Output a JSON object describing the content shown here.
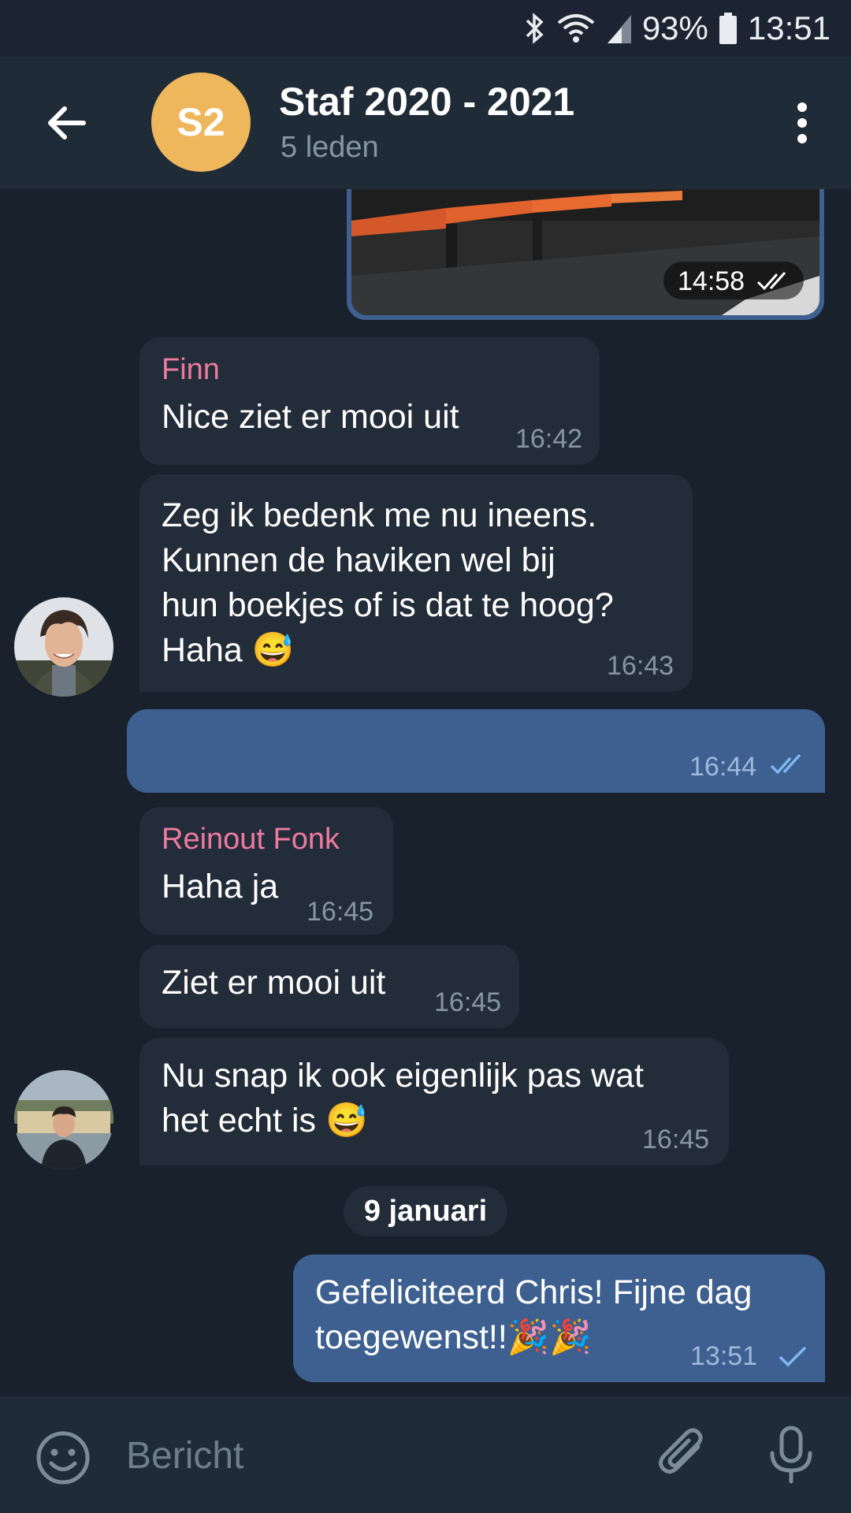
{
  "status_bar": {
    "battery": "93%",
    "time": "13:51",
    "icons": [
      "bluetooth-icon",
      "wifi-icon",
      "signal-icon",
      "battery-icon"
    ]
  },
  "header": {
    "avatar_initials": "S2",
    "title": "Staf 2020 - 2021",
    "subtitle": "5 leden",
    "colors": {
      "avatar": "#efb75c",
      "background": "#202b38"
    }
  },
  "messages": {
    "media": {
      "time": "14:58"
    },
    "finn_1": {
      "sender": "Finn",
      "text": "Nice ziet er mooi uit",
      "time": "16:42"
    },
    "finn_2": {
      "text": "Zeg ik bedenk me nu ineens.\nKunnen de haviken wel bij\nhun boekjes of is dat te hoog?\nHaha 😅",
      "time": "16:43"
    },
    "own_1": {
      "text": "",
      "time": "16:44"
    },
    "reinout_1": {
      "sender": "Reinout Fonk",
      "text": "Haha ja",
      "time": "16:45"
    },
    "reinout_2": {
      "text": "Ziet er mooi uit",
      "time": "16:45"
    },
    "reinout_3": {
      "text": "Nu snap ik ook eigenlijk pas wat\nhet echt is 😅",
      "time": "16:45"
    },
    "date_separator": "9 januari",
    "own_2": {
      "text": "Gefeliciteerd Chris! Fijne dag\ntoegewenst!!🎉🎉",
      "time": "13:51"
    }
  },
  "input": {
    "placeholder": "Bericht"
  },
  "colors": {
    "sender_name": "#ee7aa0",
    "outgoing_bubble": "#3d6090",
    "incoming_bubble": "#222d39",
    "chat_background": "#18212c"
  }
}
